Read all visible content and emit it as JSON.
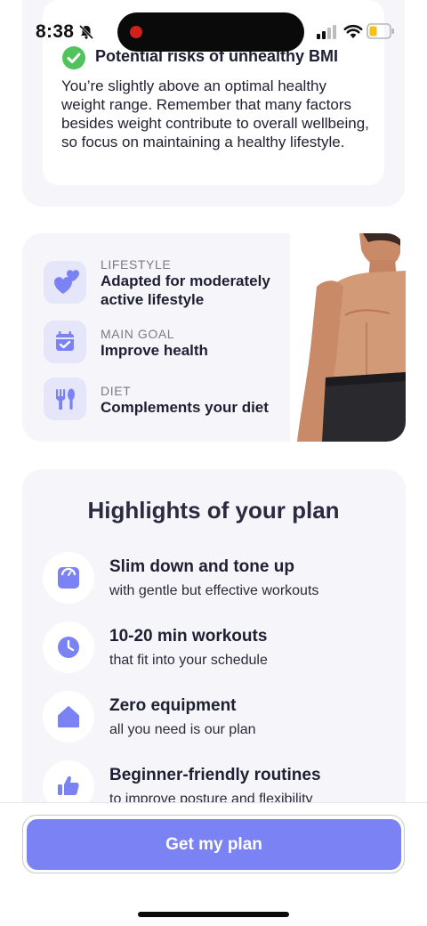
{
  "status_bar": {
    "time": "8:38"
  },
  "bmi_card": {
    "title": "Potential risks of unhealthy BMI",
    "text": "You’re slightly above an optimal healthy weight range. Remember that many factors besides weight contribute to overall wellbeing, so focus on maintaining a healthy lifestyle."
  },
  "profile": {
    "items": [
      {
        "label": "LIFESTYLE",
        "value": "Adapted for moderately active lifestyle",
        "icon": "hearts-icon"
      },
      {
        "label": "MAIN GOAL",
        "value": "Improve health",
        "icon": "calendar-check-icon"
      },
      {
        "label": "DIET",
        "value": "Complements your diet",
        "icon": "utensils-icon"
      }
    ]
  },
  "highlights": {
    "title": "Highlights of your plan",
    "items": [
      {
        "title": "Slim down and tone up",
        "subtitle": "with gentle but effective workouts",
        "icon": "scale-icon"
      },
      {
        "title": "10-20 min workouts",
        "subtitle": "that fit into your schedule",
        "icon": "clock-icon"
      },
      {
        "title": "Zero equipment",
        "subtitle": "all you need is our plan",
        "icon": "home-icon"
      },
      {
        "title": "Beginner-friendly routines",
        "subtitle": "to improve posture and flexibility",
        "icon": "thumbs-up-icon"
      }
    ]
  },
  "cta": {
    "label": "Get my plan"
  },
  "colors": {
    "accent": "#7b83f4",
    "icon_bg": "#e6e6fa",
    "card_bg": "#f6f6fa",
    "success": "#52c25a"
  }
}
